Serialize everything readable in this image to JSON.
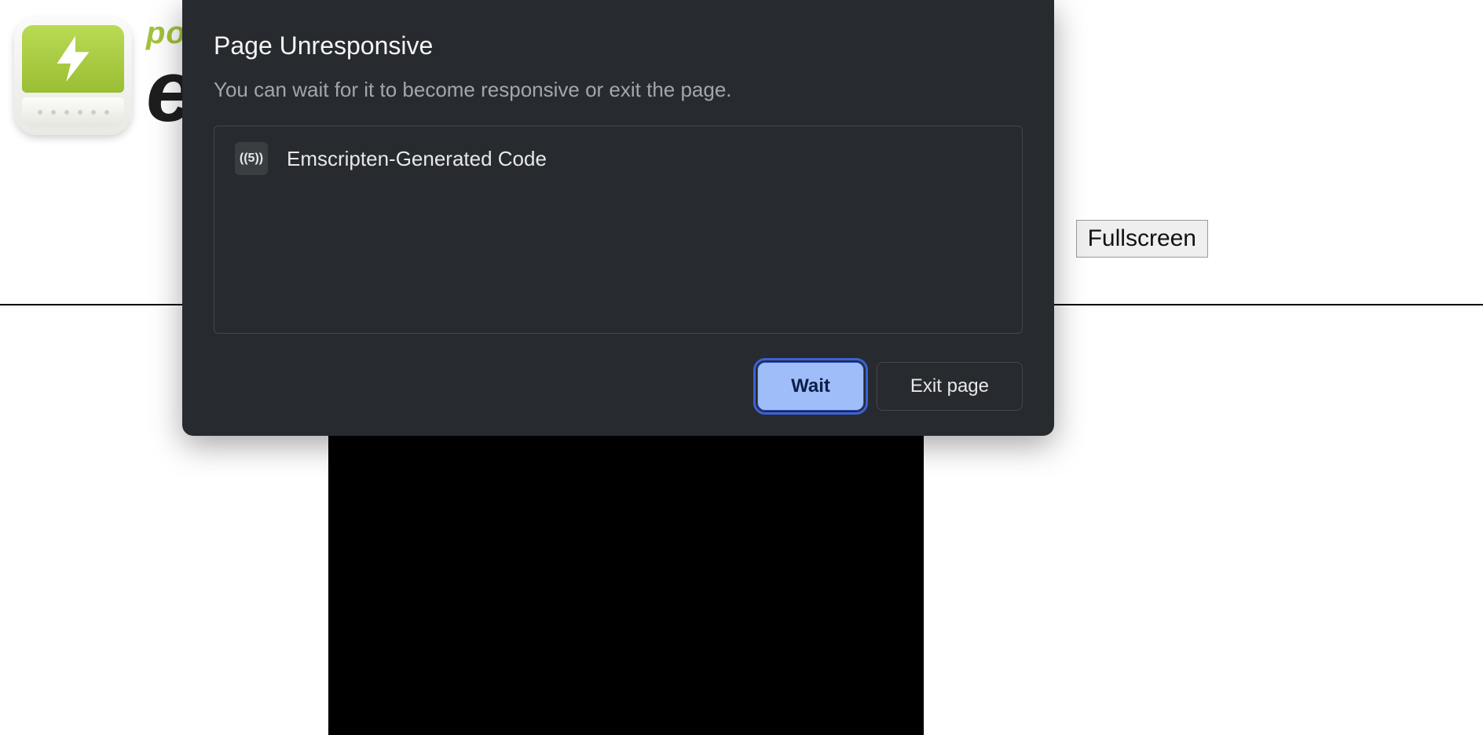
{
  "brand": {
    "top_word_visible": "po",
    "main_word_visible": "e"
  },
  "page": {
    "fullscreen_label": "Fullscreen"
  },
  "dialog": {
    "title": "Page Unresponsive",
    "message": "You can wait for it to become responsive or exit the page.",
    "process": {
      "favicon_text": "((5))",
      "name": "Emscripten-Generated Code"
    },
    "buttons": {
      "wait": "Wait",
      "exit": "Exit page"
    }
  }
}
